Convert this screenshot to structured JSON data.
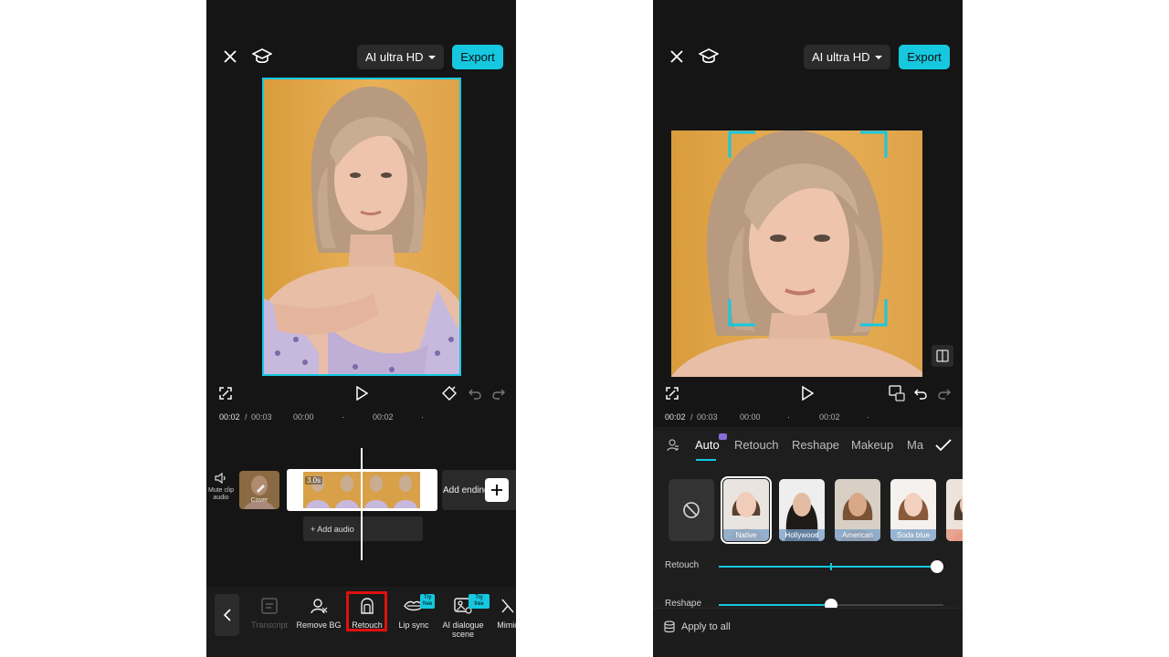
{
  "left": {
    "quality_label": "AI ultra HD",
    "export_label": "Export",
    "time_current": "00:02",
    "time_sep": "/",
    "time_total": "00:03",
    "tick_1": "00:00",
    "tick_2": "00:02",
    "mute_label": "Mute clip audio",
    "cover_label": "Cover",
    "clip_duration": "3.0s",
    "add_ending_label": "Add ending",
    "add_audio_label": "+ Add audio",
    "tools": [
      {
        "label": "Transcript",
        "icon": "transcript-icon",
        "enabled": false
      },
      {
        "label": "Remove BG",
        "icon": "remove-bg-icon",
        "enabled": true
      },
      {
        "label": "Retouch",
        "icon": "retouch-icon",
        "enabled": true,
        "highlighted": true
      },
      {
        "label": "Lip sync",
        "icon": "lip-sync-icon",
        "enabled": true,
        "badge": "Try free"
      },
      {
        "label": "AI dialogue scene",
        "icon": "ai-dialogue-icon",
        "enabled": true,
        "badge": "Try free"
      },
      {
        "label": "Mimic",
        "icon": "mimic-icon",
        "enabled": true
      }
    ]
  },
  "right": {
    "quality_label": "AI ultra HD",
    "export_label": "Export",
    "time_current": "00:02",
    "time_sep": "/",
    "time_total": "00:03",
    "tick_1": "00:00",
    "tick_2": "00:02",
    "tabs": [
      "Auto",
      "Retouch",
      "Reshape",
      "Makeup",
      "Ma"
    ],
    "active_tab": "Auto",
    "presets": [
      {
        "label": "Native",
        "selected": true
      },
      {
        "label": "Hollywood",
        "selected": false
      },
      {
        "label": "American",
        "selected": false
      },
      {
        "label": "Soda blue",
        "selected": false
      },
      {
        "label": "So",
        "selected": false
      }
    ],
    "sliders": [
      {
        "label": "Retouch",
        "value": 1.0
      },
      {
        "label": "Reshape",
        "value": 0.5
      }
    ],
    "apply_all_label": "Apply to all"
  },
  "colors": {
    "accent": "#15c8e0",
    "background": "#151515",
    "highlight": "#e01010"
  }
}
